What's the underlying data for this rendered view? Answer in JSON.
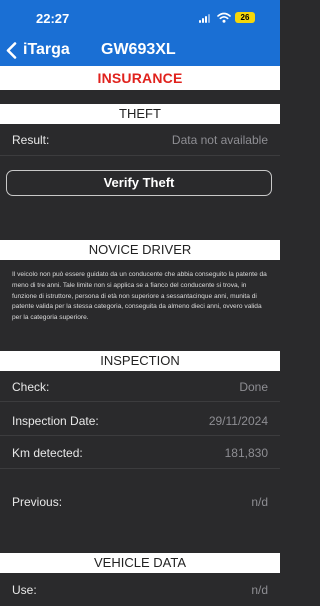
{
  "status_bar": {
    "time": "22:27",
    "battery": "26"
  },
  "nav": {
    "back_label": "iTarga",
    "title": "GW693XL"
  },
  "banner": {
    "title": "INSURANCE"
  },
  "theft": {
    "header": "THEFT",
    "result_label": "Result:",
    "result_value": "Data not available",
    "verify_button": "Verify Theft"
  },
  "novice": {
    "header": "NOVICE DRIVER",
    "text": "Il veicolo non può essere guidato da un conducente che abbia conseguito la patente da meno di tre anni. Tale limite non si applica se a fianco del conducente si trova, in funzione di istruttore, persona di età non superiore a sessantacinque anni, munita di patente valida per la stessa categoria, conseguita da almeno dieci anni, ovvero valida per la categoria superiore."
  },
  "inspection": {
    "header": "INSPECTION",
    "check_label": "Check:",
    "check_value": "Done",
    "date_label": "Inspection Date:",
    "date_value": "29/11/2024",
    "km_label": "Km detected:",
    "km_value": "181,830",
    "previous_label": "Previous:",
    "previous_value": "n/d"
  },
  "vehicle": {
    "header": "VEHICLE DATA",
    "use_label": "Use:",
    "use_value": "n/d"
  },
  "colors": {
    "nav_blue": "#1a6fd4",
    "insurance_red": "#e0221d",
    "battery_yellow": "#f5d60a"
  }
}
